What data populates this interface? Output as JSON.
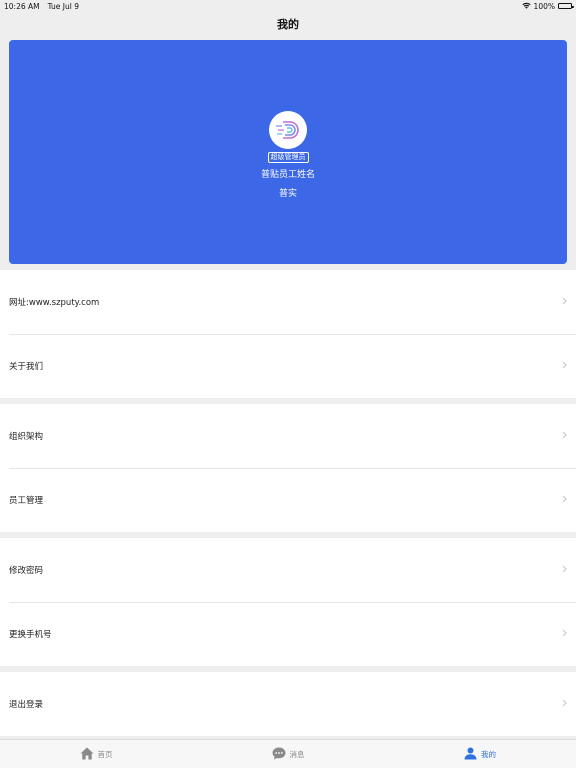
{
  "status_bar": {
    "time": "10:26 AM",
    "date": "Tue Jul 9",
    "battery": "100%"
  },
  "nav": {
    "title": "我的"
  },
  "profile": {
    "role_badge": "超级管理员",
    "name": "普贴员工姓名",
    "company": "普实",
    "accent_color": "#3c68e7"
  },
  "menu": {
    "groups": [
      {
        "items": [
          {
            "label": "网址:www.szputy.com"
          },
          {
            "label": "关于我们"
          }
        ]
      },
      {
        "items": [
          {
            "label": "组织架构"
          },
          {
            "label": "员工管理"
          }
        ]
      },
      {
        "items": [
          {
            "label": "修改密码"
          },
          {
            "label": "更换手机号"
          }
        ]
      },
      {
        "items": [
          {
            "label": "退出登录"
          }
        ]
      }
    ]
  },
  "tab_bar": {
    "tabs": [
      {
        "label": "首页",
        "icon": "home-icon",
        "active": false
      },
      {
        "label": "消息",
        "icon": "message-icon",
        "active": false
      },
      {
        "label": "我的",
        "icon": "user-icon",
        "active": true
      }
    ],
    "active_color": "#2f6fe0"
  }
}
